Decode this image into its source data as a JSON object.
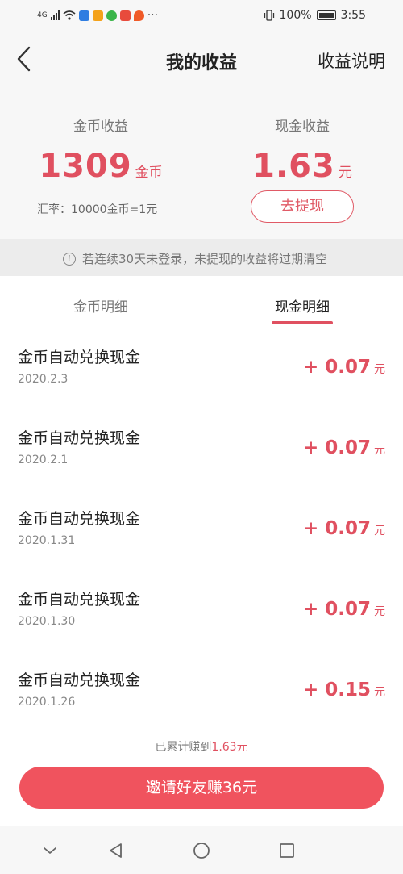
{
  "status_bar": {
    "network": "4G",
    "battery": "100%",
    "time": "3:55",
    "more": "···"
  },
  "header": {
    "title": "我的收益",
    "link": "收益说明"
  },
  "summary": {
    "coin_label": "金币收益",
    "coin_value": "1309",
    "coin_unit": "金币",
    "cash_label": "现金收益",
    "cash_value": "1.63",
    "cash_unit": "元",
    "rate": "汇率：10000金币=1元",
    "withdraw_label": "去提现"
  },
  "notice": {
    "icon": "!",
    "text": "若连续30天未登录，未提现的收益将过期清空"
  },
  "tabs": {
    "coin": "金币明细",
    "cash": "现金明细",
    "active": "cash"
  },
  "records": [
    {
      "title": "金币自动兑换现金",
      "date": "2020.2.3",
      "amount": "+ 0.07",
      "unit": "元"
    },
    {
      "title": "金币自动兑换现金",
      "date": "2020.2.1",
      "amount": "+ 0.07",
      "unit": "元"
    },
    {
      "title": "金币自动兑换现金",
      "date": "2020.1.31",
      "amount": "+ 0.07",
      "unit": "元"
    },
    {
      "title": "金币自动兑换现金",
      "date": "2020.1.30",
      "amount": "+ 0.07",
      "unit": "元"
    },
    {
      "title": "金币自动兑换现金",
      "date": "2020.1.26",
      "amount": "+ 0.15",
      "unit": "元"
    }
  ],
  "total": {
    "prefix": "已累计赚到",
    "value": "1.63元"
  },
  "invite_label": "邀请好友赚36元",
  "colors": {
    "accent": "#e05060",
    "button": "#f0535e",
    "background": "#f7f7f7"
  }
}
